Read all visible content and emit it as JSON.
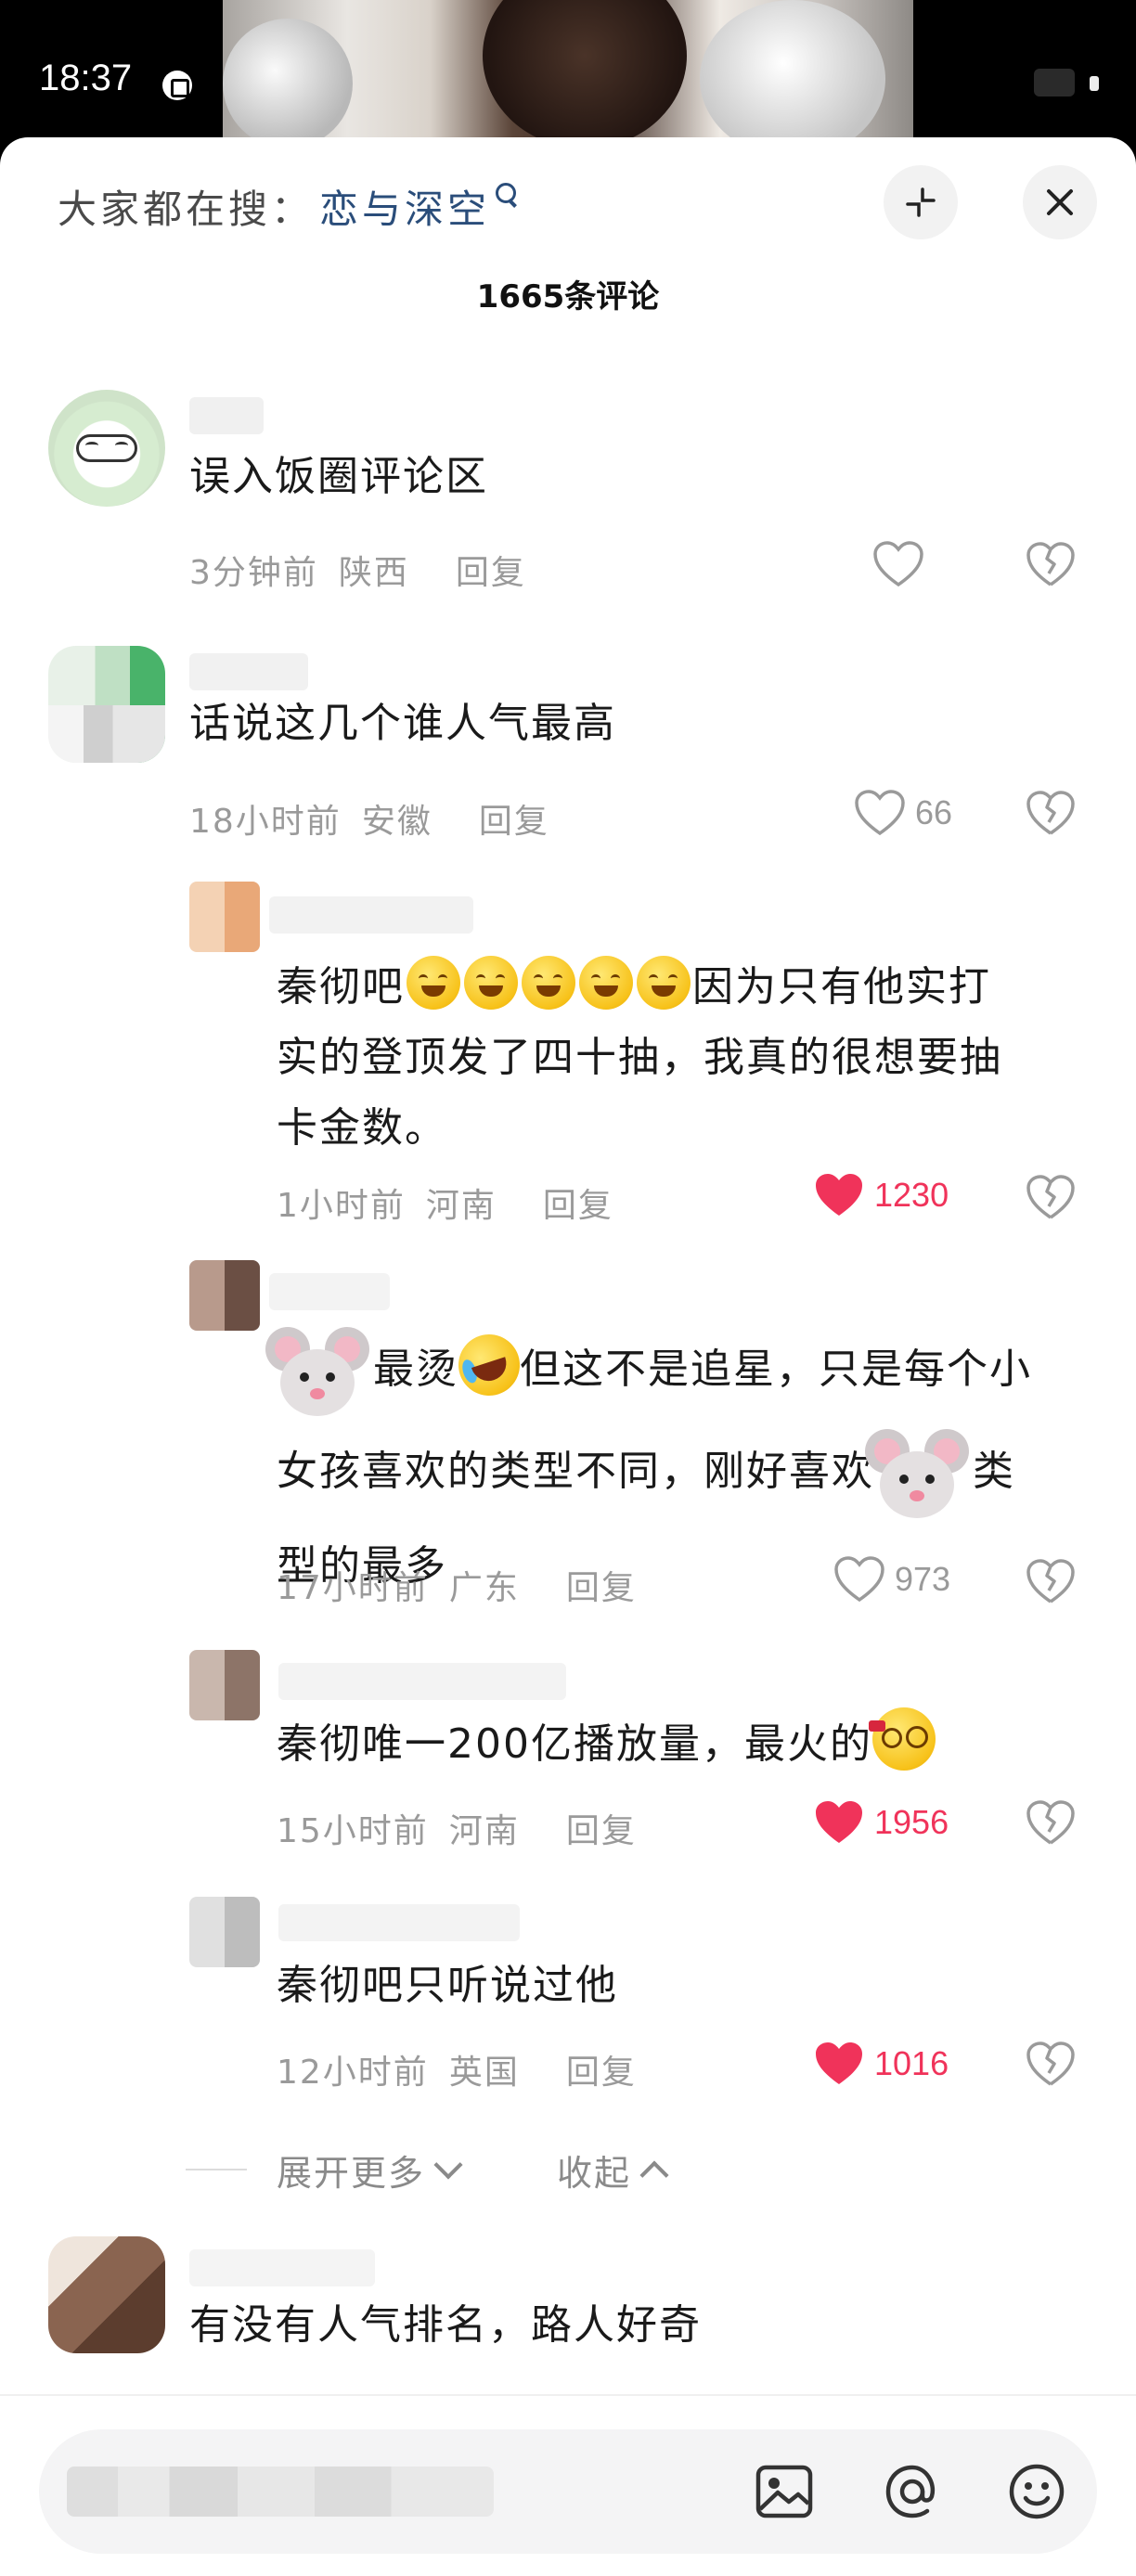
{
  "status_bar": {
    "time": "18:37"
  },
  "sheet": {
    "search_prefix": "大家都在搜：",
    "search_term": "恋与深空",
    "comment_count": "1665条评论"
  },
  "comments": [
    {
      "text": "误入饭圈评论区",
      "time": "3分钟前",
      "location": "陕西",
      "reply_label": "回复",
      "likes": "",
      "liked": false
    },
    {
      "text": "话说这几个谁人气最高",
      "time": "18小时前",
      "location": "安徽",
      "reply_label": "回复",
      "likes": "66",
      "liked": false,
      "replies": [
        {
          "text_prefix": "秦彻吧",
          "text_line1_suffix": "因为只有他实打",
          "text_line2": "实的登顶发了四十抽，我真的很想要抽",
          "text_line3": "卡金数。",
          "time": "1小时前",
          "location": "河南",
          "reply_label": "回复",
          "likes": "1230",
          "liked": true
        },
        {
          "text_seg1": "最烫",
          "text_seg2": "但这不是追星，只是每个小",
          "text_line2a": "女孩喜欢的类型不同，刚好喜欢",
          "text_line2b": "类",
          "text_line3": "型的最多",
          "time": "17小时前",
          "location": "广东",
          "reply_label": "回复",
          "likes": "973",
          "liked": false
        },
        {
          "text": "秦彻唯一200亿播放量，最火的",
          "time": "15小时前",
          "location": "河南",
          "reply_label": "回复",
          "likes": "1956",
          "liked": true
        },
        {
          "text": "秦彻吧只听说过他",
          "time": "12小时前",
          "location": "英国",
          "reply_label": "回复",
          "likes": "1016",
          "liked": true
        }
      ]
    },
    {
      "text": "有没有人气排名，路人好奇"
    }
  ],
  "thread_controls": {
    "expand_label": "展开更多",
    "collapse_label": "收起"
  },
  "icons": {
    "minimize": "minimize-icon",
    "close": "close-icon",
    "like": "heart-outline-icon",
    "liked": "heart-filled-icon",
    "dislike": "broken-heart-icon",
    "image": "image-icon",
    "mention": "at-icon",
    "emoji": "emoji-icon"
  },
  "colors": {
    "liked": "#f0335a",
    "search_term": "#2a4d7a",
    "meta": "#9a9a9a"
  }
}
